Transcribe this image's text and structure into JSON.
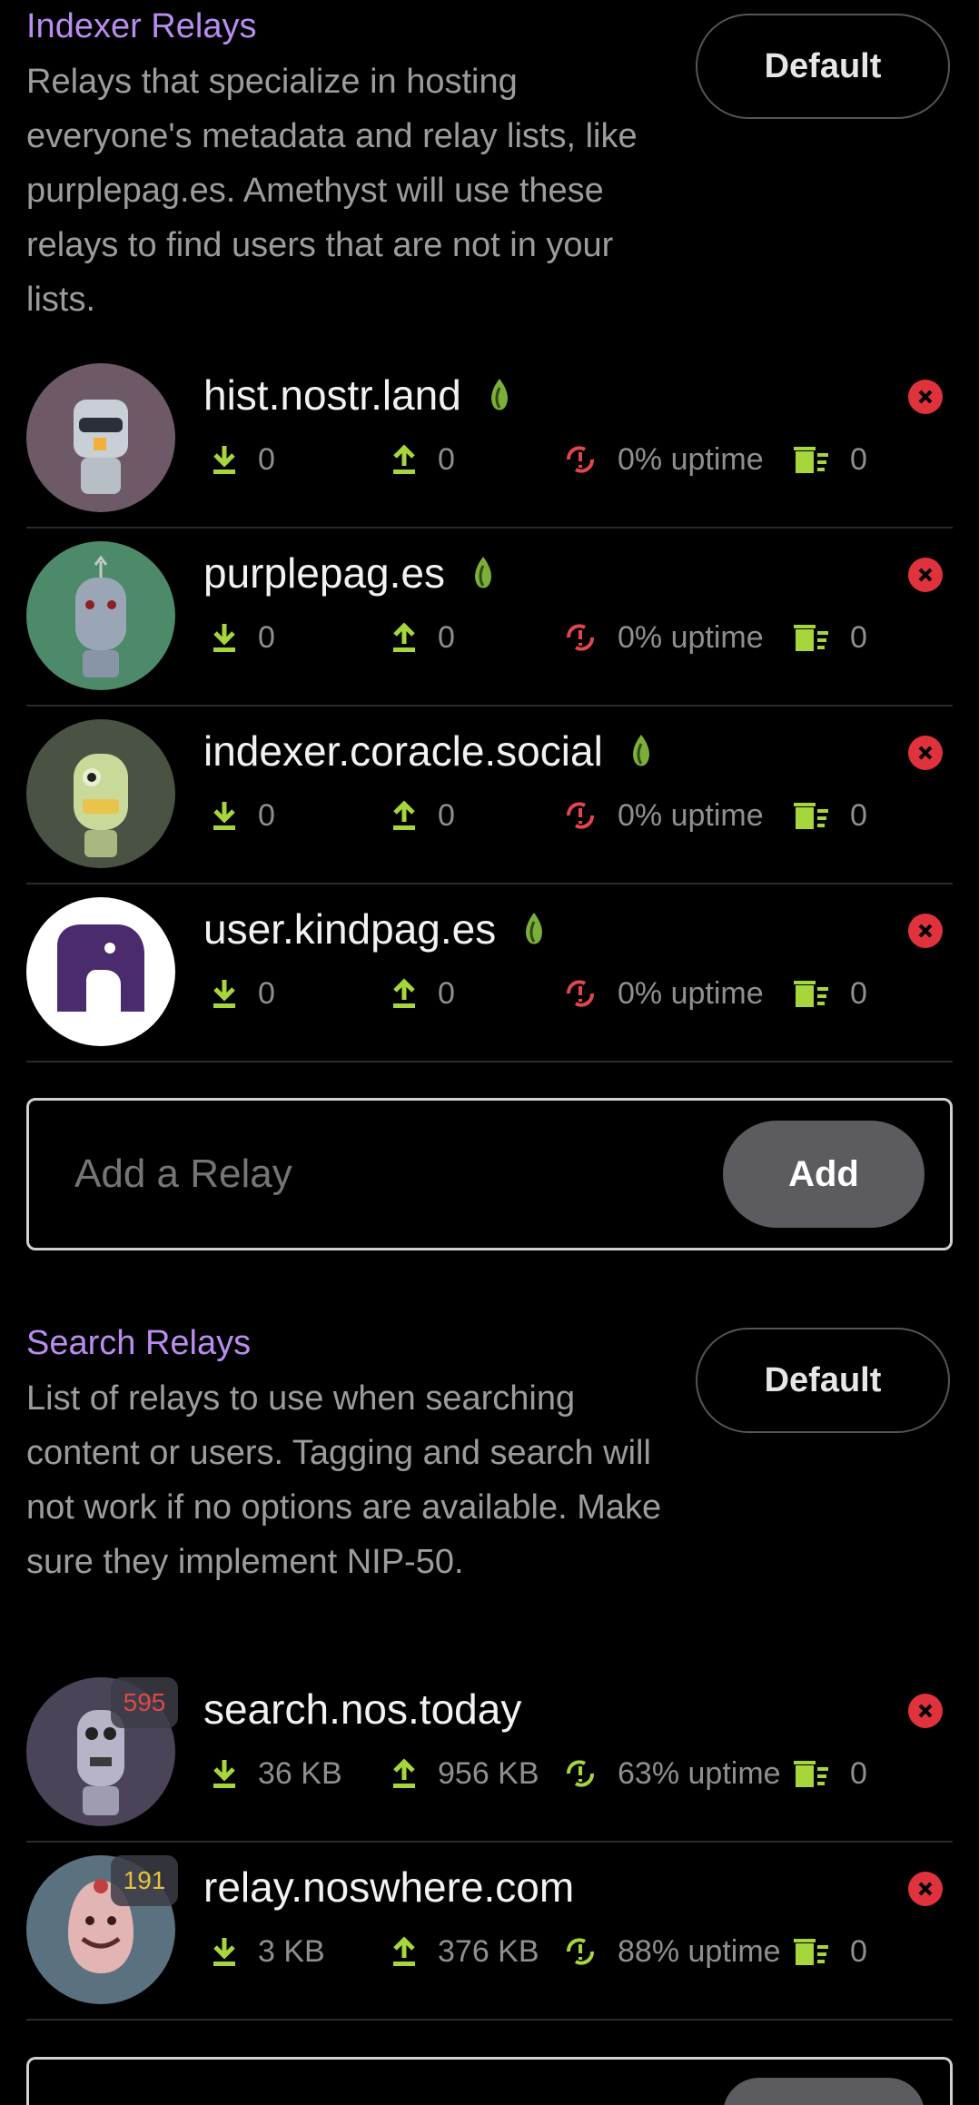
{
  "indexer": {
    "title": "Indexer Relays",
    "description": "Relays that specialize in hosting everyone's metadata and relay lists, like purplepag.es. Amethyst will use these relays to find users that are not in your lists.",
    "default_label": "Default",
    "relays": [
      {
        "name": "hist.nostr.land",
        "download": "0",
        "upload": "0",
        "uptime": "0% uptime",
        "spam": "0",
        "avatar_bg": "#6e5a66"
      },
      {
        "name": "purplepag.es",
        "download": "0",
        "upload": "0",
        "uptime": "0% uptime",
        "spam": "0",
        "avatar_bg": "#4d8a6a"
      },
      {
        "name": "indexer.coracle.social",
        "download": "0",
        "upload": "0",
        "uptime": "0% uptime",
        "spam": "0",
        "avatar_bg": "#4a5244"
      },
      {
        "name": "user.kindpag.es",
        "download": "0",
        "upload": "0",
        "uptime": "0% uptime",
        "spam": "0",
        "avatar_bg": "#ffffff"
      }
    ],
    "add_placeholder": "Add a Relay",
    "add_label": "Add"
  },
  "search": {
    "title": "Search Relays",
    "description": "List of relays to use when searching content or users. Tagging and search will not work if no options are available. Make sure they implement NIP-50.",
    "default_label": "Default",
    "relays": [
      {
        "name": "search.nos.today",
        "badge": "595",
        "download": "36 KB",
        "upload": "956 KB",
        "uptime": "63% uptime",
        "spam": "0",
        "avatar_bg": "#4b4458"
      },
      {
        "name": "relay.noswhere.com",
        "badge": "191",
        "download": "3 KB",
        "upload": "376 KB",
        "uptime": "88% uptime",
        "spam": "0",
        "avatar_bg": "#5a7280"
      }
    ]
  },
  "colors": {
    "accent": "#b98cf0",
    "stat_icon": "#a6d63c",
    "uptime_bad": "#e0474c",
    "uptime_good": "#a6d63c",
    "remove": "#e0323c",
    "badge_red": "#e04848",
    "badge_yellow": "#e8c23a"
  }
}
